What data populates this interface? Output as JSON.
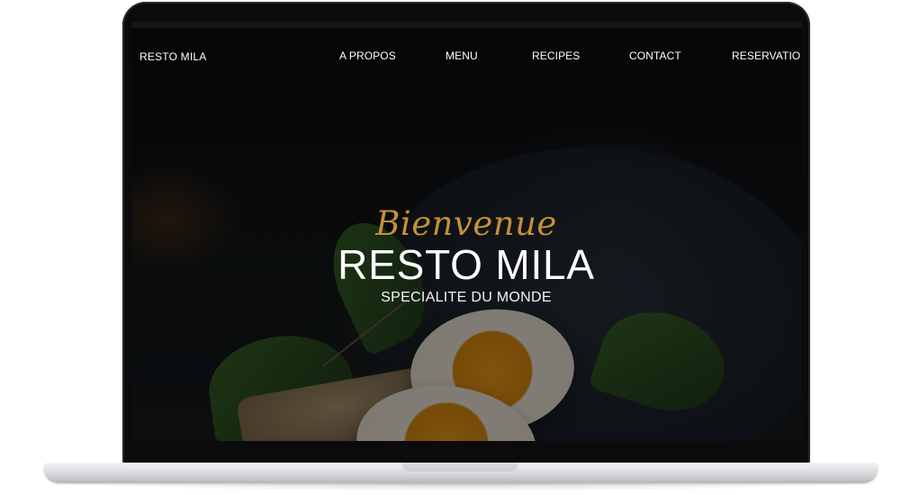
{
  "navbar": {
    "brand": "RESTO MILA",
    "items": [
      {
        "label": "A PROPOS"
      },
      {
        "label": "MENU"
      },
      {
        "label": "RECIPES"
      },
      {
        "label": "CONTACT"
      },
      {
        "label": "RESERVATION"
      }
    ]
  },
  "hero": {
    "welcome": "Bienvenue",
    "title": "RESTO MILA",
    "subtitle": "SPECIALITE DU MONDE"
  },
  "colors": {
    "accent": "#c48f3a",
    "text": "#ffffff",
    "overlay": "#000000"
  }
}
